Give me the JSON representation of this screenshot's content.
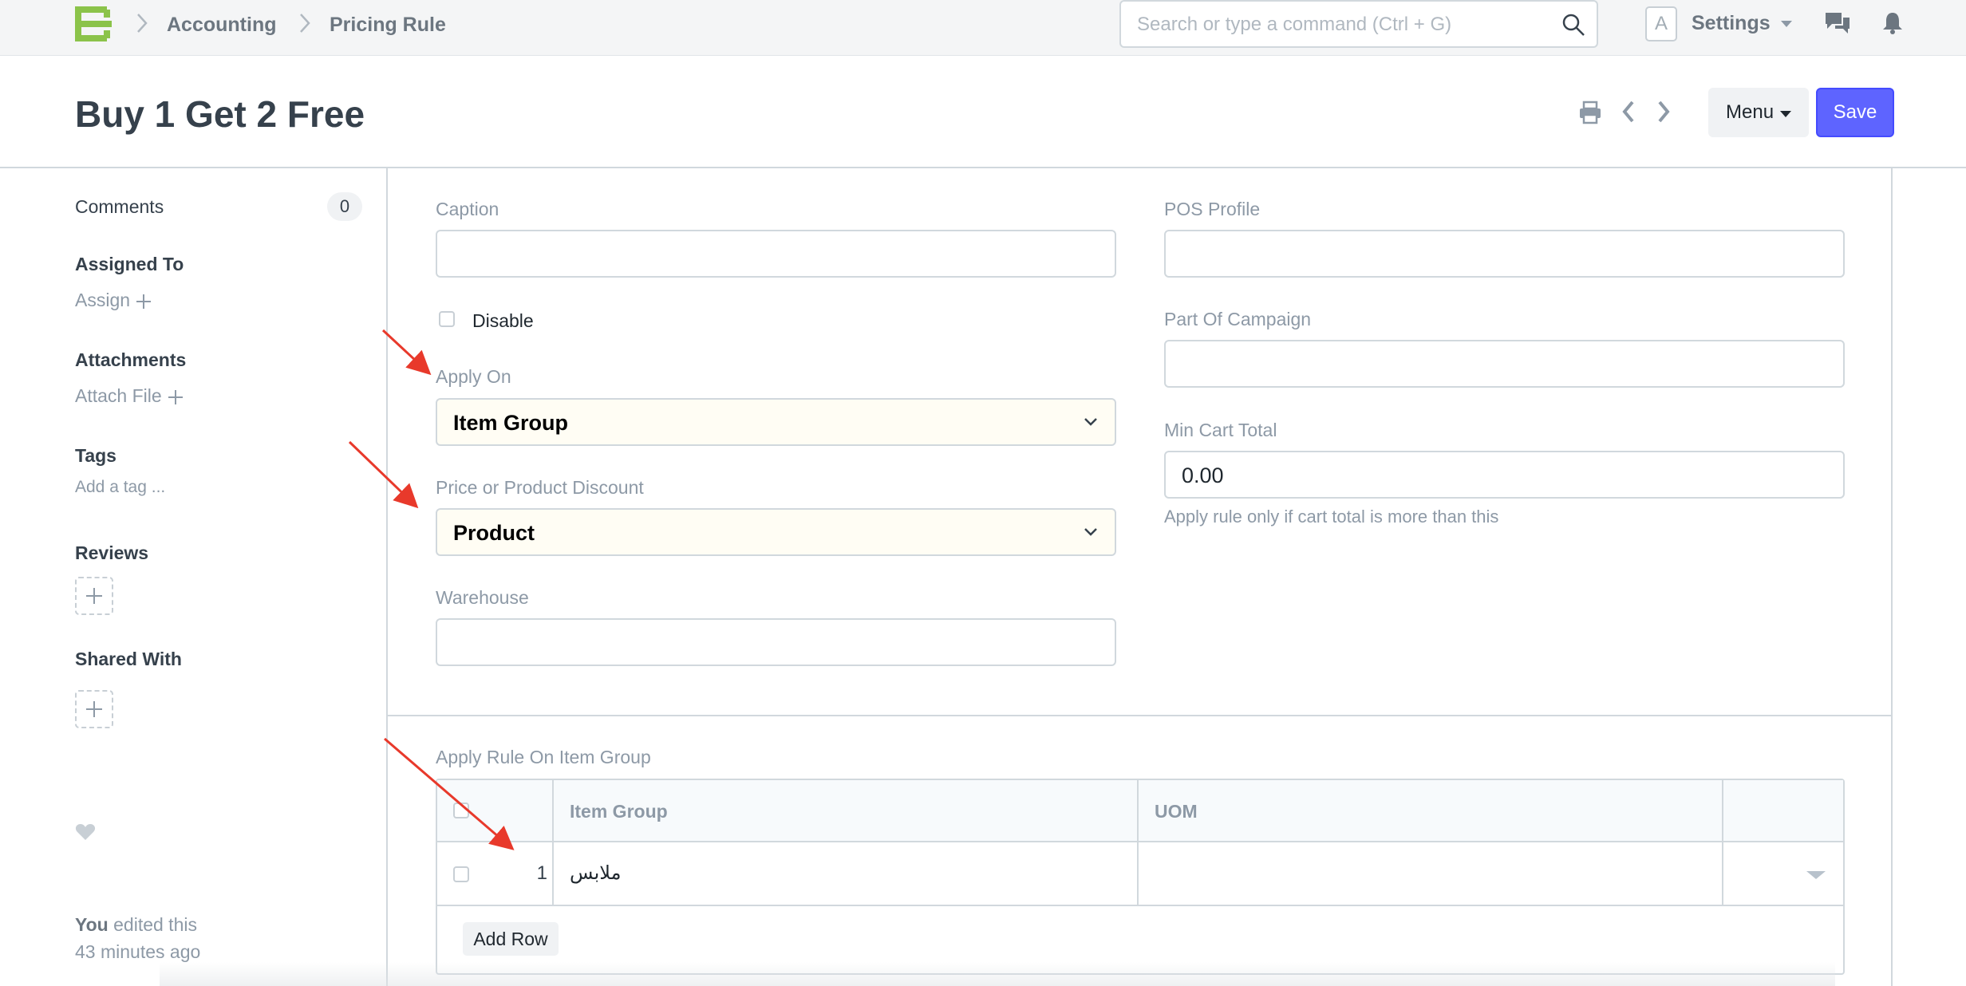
{
  "navbar": {
    "breadcrumbs": [
      "Accounting",
      "Pricing Rule"
    ],
    "search_placeholder": "Search or type a command (Ctrl + G)",
    "avatar_letter": "A",
    "settings_label": "Settings",
    "icons": [
      "app-logo-icon",
      "search-icon",
      "chat-icon",
      "bell-icon"
    ]
  },
  "page": {
    "title": "Buy 1 Get 2 Free",
    "menu_label": "Menu",
    "save_label": "Save",
    "icons": [
      "print-icon",
      "chevron-left-icon",
      "chevron-right-icon"
    ]
  },
  "sidebar": {
    "comments_label": "Comments",
    "comments_count": "0",
    "assigned_to_label": "Assigned To",
    "assign_label": "Assign",
    "attachments_label": "Attachments",
    "attach_file_label": "Attach File",
    "tags_label": "Tags",
    "add_tag_label": "Add a tag ...",
    "reviews_label": "Reviews",
    "shared_with_label": "Shared With",
    "activity_user": "You",
    "activity_text": " edited this",
    "activity_time": "43 minutes ago"
  },
  "form": {
    "caption": {
      "label": "Caption",
      "value": ""
    },
    "disable": {
      "label": "Disable",
      "checked": false
    },
    "apply_on": {
      "label": "Apply On",
      "value": "Item Group"
    },
    "price_or_product_discount": {
      "label": "Price or Product Discount",
      "value": "Product"
    },
    "warehouse": {
      "label": "Warehouse",
      "value": ""
    },
    "pos_profile": {
      "label": "POS Profile",
      "value": ""
    },
    "part_of_campaign": {
      "label": "Part Of Campaign",
      "value": ""
    },
    "min_cart_total": {
      "label": "Min Cart Total",
      "value": "0.00",
      "help": "Apply rule only if cart total is more than this"
    }
  },
  "item_group_table": {
    "label": "Apply Rule On Item Group",
    "columns": [
      "Item Group",
      "UOM"
    ],
    "rows": [
      {
        "idx": "1",
        "item_group": "ملابس",
        "uom": ""
      }
    ],
    "add_row_label": "Add Row"
  },
  "colors": {
    "primary": "#5e64ff",
    "annotation_arrow": "#e8392b",
    "select_background": "#fffdf4"
  }
}
